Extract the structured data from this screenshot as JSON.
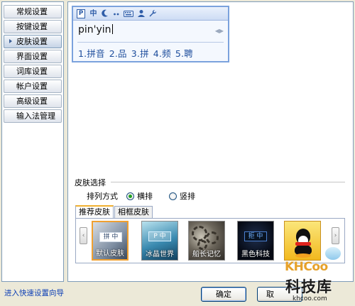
{
  "sidebar": {
    "items": [
      {
        "label": "常规设置"
      },
      {
        "label": "按键设置"
      },
      {
        "label": "皮肤设置",
        "active": true
      },
      {
        "label": "界面设置"
      },
      {
        "label": "词库设置"
      },
      {
        "label": "帐户设置"
      },
      {
        "label": "高级设置"
      },
      {
        "label": "输入法管理"
      }
    ],
    "quick_link": "进入快速设置向导"
  },
  "preview": {
    "toolbar_icons": [
      "ime-logo-icon",
      "chinese-mode-icon",
      "halfwidth-moon-icon",
      "punctuation-icon",
      "keyboard-icon",
      "user-icon",
      "wrench-icon"
    ],
    "logo_letter": "P",
    "mode_char": "中",
    "input_text": "pin'yin",
    "candidates": [
      "1.拼音",
      "2.品",
      "3.拼",
      "4.频",
      "5.聘"
    ]
  },
  "skin_select": {
    "group_title": "皮肤选择",
    "arrange_label": "排列方式",
    "radio_options": [
      {
        "label": "横排",
        "checked": true
      },
      {
        "label": "竖排",
        "checked": false
      }
    ],
    "tabs": [
      {
        "label": "推荐皮肤",
        "active": true
      },
      {
        "label": "相框皮肤",
        "active": false
      }
    ],
    "skins": [
      {
        "label": "默认皮肤",
        "logo": "拼 中",
        "selected": true
      },
      {
        "label": "冰晶世界",
        "logo": "P 中"
      },
      {
        "label": "船长记忆"
      },
      {
        "label": "黑色科技",
        "logo": "拒 中"
      },
      {
        "label": ""
      }
    ]
  },
  "buttons": {
    "ok": "确定",
    "second_partial": "取"
  },
  "watermark": {
    "brand": "KHCoo",
    "cn": "科技库",
    "url": "khcoo.com"
  },
  "colors": {
    "accent_blue": "#2f5da8",
    "selection_orange": "#f0a030",
    "window_bg": "#ece9d8"
  }
}
